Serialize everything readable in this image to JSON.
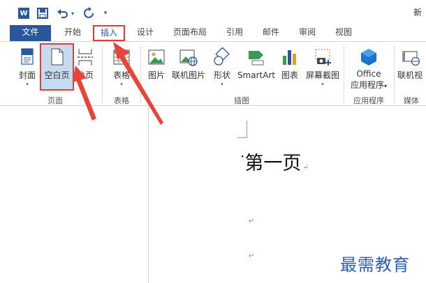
{
  "titlebar": {
    "app_icon": "word-logo-icon",
    "app_icon_glyph": "W",
    "undo_glyph": "↶",
    "redo_glyph": "↺",
    "dropdown_glyph": "▾",
    "doc_title": "新"
  },
  "tabs": [
    {
      "label": "文件"
    },
    {
      "label": "开始"
    },
    {
      "label": "插入"
    },
    {
      "label": "设计"
    },
    {
      "label": "页面布局"
    },
    {
      "label": "引用"
    },
    {
      "label": "邮件"
    },
    {
      "label": "审阅"
    },
    {
      "label": "视图"
    }
  ],
  "ribbon": {
    "pages_group": {
      "label": "页面",
      "cover_label": "封面",
      "blank_label": "空白页",
      "break_label": "分页"
    },
    "tables_group": {
      "label": "表格",
      "table_label": "表格"
    },
    "illustrations_group": {
      "label": "插图",
      "picture_label": "图片",
      "online_picture_label": "联机图片",
      "shapes_label": "形状",
      "smartart_label": "SmartArt",
      "chart_label": "图表",
      "screenshot_label": "屏幕截图"
    },
    "apps_group": {
      "label": "应用程序",
      "office_label_line1": "Office",
      "office_label_line2": "应用程序"
    },
    "media_group": {
      "label": "媒体",
      "online_video_label": "联机视"
    },
    "dropdown_glyph": "▾"
  },
  "document": {
    "heading": "第一页",
    "paragraph_mark": "↵"
  },
  "watermark": "最需教育",
  "colors": {
    "accent": "#2b579a",
    "highlight_border": "#e03b3b",
    "selected_fill": "#c5dcf0",
    "watermark": "#2b5fb0"
  }
}
